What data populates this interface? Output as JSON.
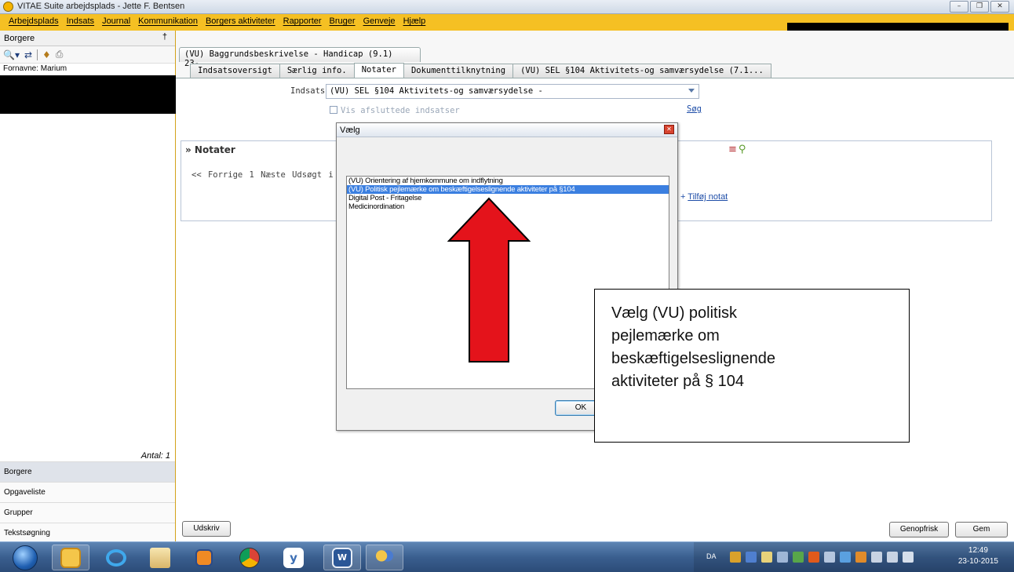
{
  "window": {
    "title": "VITAE Suite arbejdsplads - Jette F. Bentsen",
    "controls": [
      "–",
      "❒",
      "✕"
    ]
  },
  "menu": [
    "Arbejdsplads",
    "Indsats",
    "Journal",
    "Kommunikation",
    "Borgers aktiviteter",
    "Rapporter",
    "Bruger",
    "Genveje",
    "Hjælp"
  ],
  "sidebar": {
    "header": "Borgere",
    "pin_icon": "†",
    "fornavne": "Fornavne: Marium",
    "antal": "Antal: 1",
    "nav": [
      "Borgere",
      "Opgaveliste",
      "Grupper",
      "Tekstsøgning"
    ]
  },
  "tabs": {
    "outer": "(VU) Baggrundsbeskrivelse - Handicap (9.1) 23-...",
    "inner": [
      "Indsatsoversigt",
      "Særlig info.",
      "Notater",
      "Dokumenttilknytning",
      "(VU) SEL §104 Aktivitets-og samværsydelse (7.1..."
    ],
    "active_index": 2
  },
  "form": {
    "indsats_label": "Indsats",
    "indsats_value": "(VU) SEL §104 Aktivitets-og samværsydelse -",
    "vis_label": "Vis afsluttede indsatser",
    "sog_link": "Søg"
  },
  "notater": {
    "title": "» Notater",
    "pager": "<<  Forrige  1  Næste  Udsøgt i",
    "add_note": "Tilføj notat",
    "add_icon": "+",
    "icon_symbols": [
      "≡",
      "⚲"
    ]
  },
  "dialog": {
    "title": "Vælg",
    "close_glyph": "✕",
    "items": [
      "(VU) Orientering af hjemkommune om indflytning",
      "(VU) Politisk pejlemærke om beskæftigelseslignende aktiviteter på §104",
      "Digital Post - Fritagelse",
      "Medicinordination"
    ],
    "selected_index": 1,
    "ok_label": "OK"
  },
  "callout": {
    "lines": [
      "Vælg (VU) politisk",
      "pejlemærke om",
      "beskæftigelseslignende",
      "aktiviteter på § 104"
    ]
  },
  "buttons": {
    "print": "Udskriv",
    "refresh": "Genopfrisk",
    "save": "Gem"
  },
  "taskbar": {
    "language": "DA",
    "time": "12:49",
    "date": "23-10-2015",
    "apps": [
      "start-button",
      "outlook",
      "internet-explorer",
      "file-explorer",
      "media",
      "chrome",
      "yammer",
      "word",
      "vitae"
    ]
  },
  "colors": {
    "menubar": "#f5c023",
    "accent_red": "#e4131b",
    "link": "#1f4ea8",
    "selection": "#3b7fe0"
  }
}
